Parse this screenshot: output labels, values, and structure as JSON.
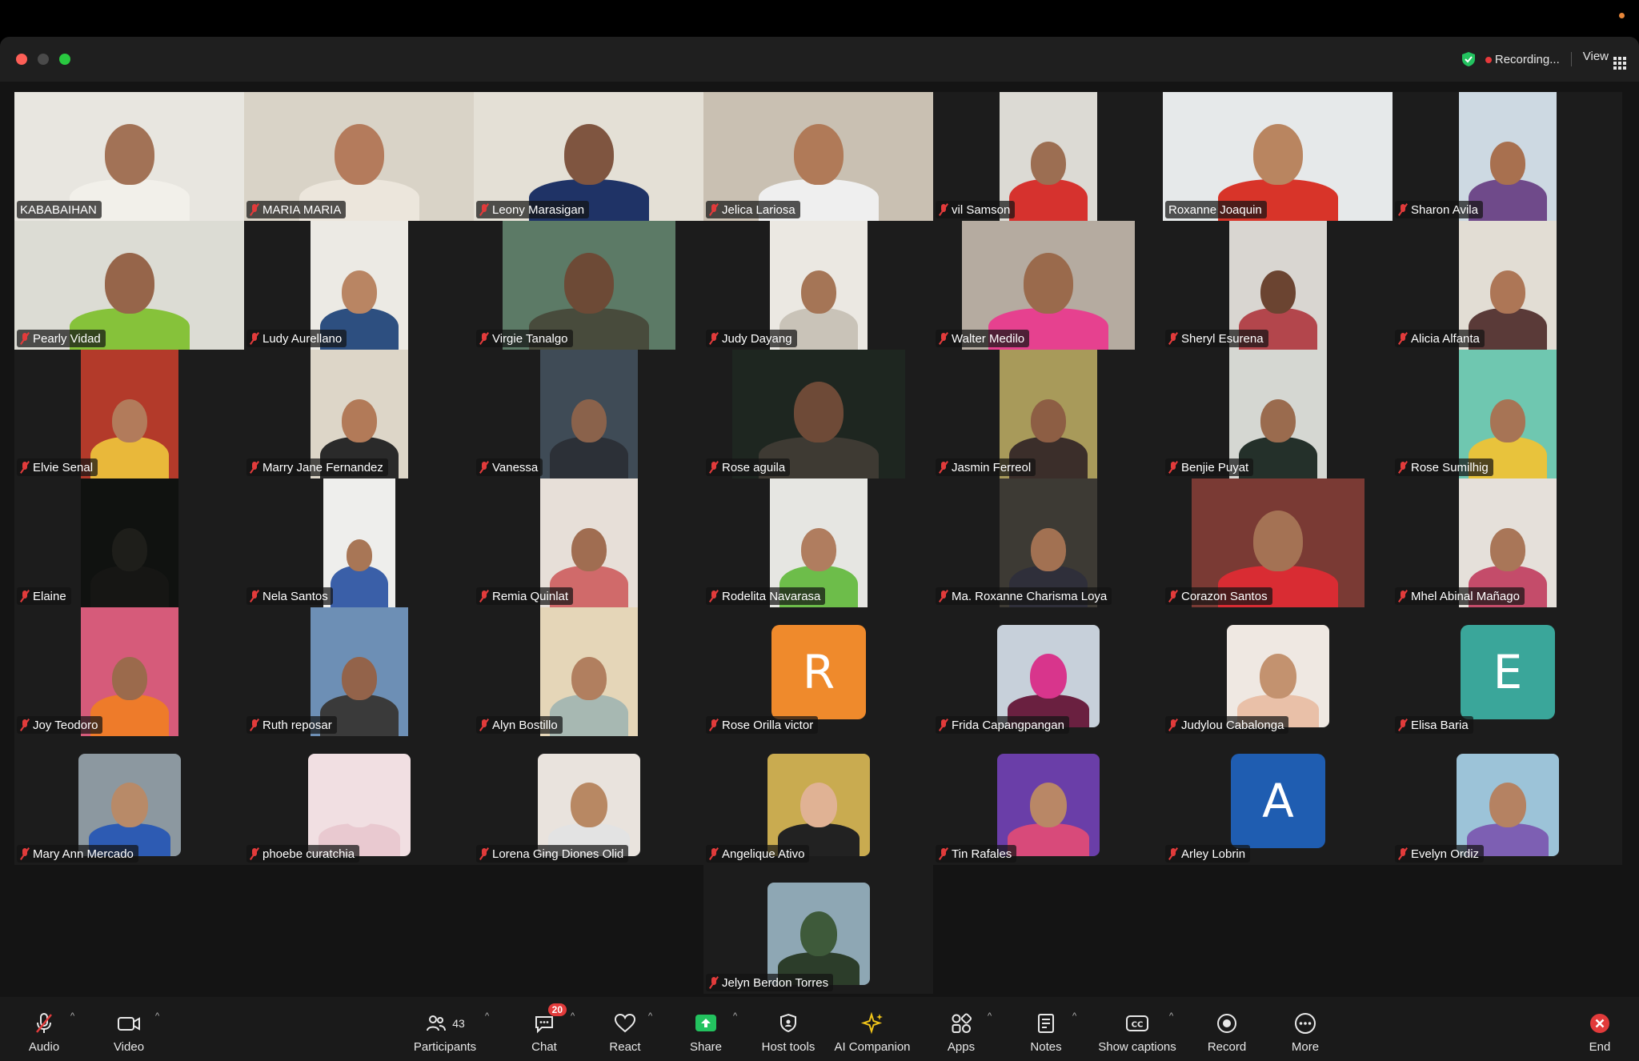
{
  "window": {
    "recording_label": "Recording...",
    "view_label": "View"
  },
  "participants": [
    {
      "name": "KABABAIHAN",
      "muted": false,
      "kind": "video",
      "bg": "#e8e6e0",
      "skin": "#a27256",
      "shirt": "#f2f0ea"
    },
    {
      "name": "MARIA MARIA",
      "muted": true,
      "kind": "video",
      "bg": "#d9d3c7",
      "skin": "#b47b5c",
      "shirt": "#ece6dc"
    },
    {
      "name": "Leony Marasigan",
      "muted": true,
      "kind": "video",
      "bg": "#e4e0d6",
      "skin": "#7f5540",
      "shirt": "#1f3366"
    },
    {
      "name": "Jelica Lariosa",
      "muted": true,
      "kind": "video",
      "bg": "#c9c0b2",
      "skin": "#b07a58",
      "shirt": "#efefef"
    },
    {
      "name": "vil Samson",
      "muted": true,
      "kind": "video",
      "bg": "#dcdad4",
      "skin": "#9c6e52",
      "shirt": "#d6322e"
    },
    {
      "name": "Roxanne Joaquin",
      "muted": false,
      "kind": "video",
      "bg": "#e6e9ea",
      "skin": "#b98560",
      "shirt": "#d83429"
    },
    {
      "name": "Sharon Avila",
      "muted": true,
      "kind": "video",
      "bg": "#cdd9e2",
      "skin": "#a8704f",
      "shirt": "#6f4a8a"
    },
    {
      "name": "Pearly Vidad",
      "muted": true,
      "kind": "video",
      "bg": "#dcdcd4",
      "skin": "#96654a",
      "shirt": "#86c23a"
    },
    {
      "name": "Ludy Aurellano",
      "muted": true,
      "kind": "video",
      "bg": "#eceae4",
      "skin": "#b98563",
      "shirt": "#2d4f80"
    },
    {
      "name": "Virgie Tanalgo",
      "muted": true,
      "kind": "video",
      "bg": "#5c7a66",
      "skin": "#6d4a36",
      "shirt": "#484b3c"
    },
    {
      "name": "Judy Dayang",
      "muted": true,
      "kind": "video",
      "bg": "#ebe8e2",
      "skin": "#a57556",
      "shirt": "#c9c3b8"
    },
    {
      "name": "Walter Medilo",
      "muted": true,
      "kind": "video",
      "bg": "#b5aba0",
      "skin": "#9a6a4c",
      "shirt": "#e6418f"
    },
    {
      "name": "Sheryl Esurena",
      "muted": true,
      "kind": "video",
      "bg": "#d9d6d1",
      "skin": "#6b4431",
      "shirt": "#b3464c"
    },
    {
      "name": "Alicia Alfanta",
      "muted": true,
      "kind": "video",
      "bg": "#e2ddd4",
      "skin": "#ad7656",
      "shirt": "#5a3a38"
    },
    {
      "name": "Elvie Senal",
      "muted": true,
      "kind": "video",
      "bg": "#b33a2a",
      "skin": "#b27b5b",
      "shirt": "#e9b83a"
    },
    {
      "name": "Marry Jane Fernandez",
      "muted": true,
      "kind": "video",
      "bg": "#ddd6c8",
      "skin": "#b27a58",
      "shirt": "#2a2a2a"
    },
    {
      "name": "Vanessa",
      "muted": true,
      "kind": "video",
      "bg": "#3f4b56",
      "skin": "#8a624b",
      "shirt": "#2c3037"
    },
    {
      "name": "Rose aguila",
      "muted": true,
      "kind": "video",
      "bg": "#1e2620",
      "skin": "#6e4a37",
      "shirt": "#3e3a33"
    },
    {
      "name": "Jasmin Ferreol",
      "muted": true,
      "kind": "video",
      "bg": "#a89a5a",
      "skin": "#8d5e44",
      "shirt": "#3b2e2a"
    },
    {
      "name": "Benjie Puyat",
      "muted": true,
      "kind": "video",
      "bg": "#d5d7d2",
      "skin": "#9a6b4e",
      "shirt": "#24302a"
    },
    {
      "name": "Rose Sumilhig",
      "muted": true,
      "kind": "video",
      "bg": "#6fc7b0",
      "skin": "#a77455",
      "shirt": "#e8c33c"
    },
    {
      "name": "Elaine",
      "muted": true,
      "kind": "video",
      "bg": "#101210",
      "skin": "#1e1e1a",
      "shirt": "#161614"
    },
    {
      "name": "Nela Santos",
      "muted": true,
      "kind": "video",
      "bg": "#eeeeec",
      "skin": "#a87656",
      "shirt": "#3a5fa8"
    },
    {
      "name": "Remia Quinlat",
      "muted": true,
      "kind": "video",
      "bg": "#e7dfd8",
      "skin": "#a06d51",
      "shirt": "#d06a6a"
    },
    {
      "name": "Rodelita Navarasa",
      "muted": true,
      "kind": "video",
      "bg": "#e6e6e2",
      "skin": "#b07d5f",
      "shirt": "#6dbd4a"
    },
    {
      "name": "Ma. Roxanne Charisma Loya",
      "muted": true,
      "kind": "video",
      "bg": "#3d3a34",
      "skin": "#a27152",
      "shirt": "#2f2f3a"
    },
    {
      "name": "Corazon Santos",
      "muted": true,
      "kind": "video",
      "bg": "#7a3a34",
      "skin": "#a47254",
      "shirt": "#d92c33"
    },
    {
      "name": "Mhel Abinal Mañago",
      "muted": true,
      "kind": "video",
      "bg": "#e5e0da",
      "skin": "#a97658",
      "shirt": "#c44c6a"
    },
    {
      "name": "Joy Teodoro",
      "muted": true,
      "kind": "video",
      "bg": "#d65b7a",
      "skin": "#9b6a4c",
      "shirt": "#ee7b2a"
    },
    {
      "name": "Ruth reposar",
      "muted": true,
      "kind": "video",
      "bg": "#6d8fb5",
      "skin": "#93634a",
      "shirt": "#3a3a3a"
    },
    {
      "name": "Alyn Bostillo",
      "muted": true,
      "kind": "video",
      "bg": "#e5d6b8",
      "skin": "#b17f5f",
      "shirt": "#a7b8b2"
    },
    {
      "name": "Rose Orilla victor",
      "muted": true,
      "kind": "letter",
      "letter": "R",
      "color": "#ef8a2c"
    },
    {
      "name": "Frida Capangpangan",
      "muted": true,
      "kind": "photo",
      "bg": "#c7d0da",
      "skin": "#d8358c",
      "shirt": "#6a2040"
    },
    {
      "name": "Judylou Cabalonga",
      "muted": true,
      "kind": "photo",
      "bg": "#efe8e2",
      "skin": "#c3926f",
      "shirt": "#e9c0a8"
    },
    {
      "name": "Elisa Baria",
      "muted": true,
      "kind": "letter",
      "letter": "E",
      "color": "#3aa69a"
    },
    {
      "name": "Mary Ann Mercado",
      "muted": true,
      "kind": "photo",
      "bg": "#8c98a0",
      "skin": "#b88a68",
      "shirt": "#2d5bb3"
    },
    {
      "name": "phoebe curatchia",
      "muted": true,
      "kind": "photo",
      "bg": "#f1dfe2",
      "skin": "#f1dfe2",
      "shirt": "#e9c9d0"
    },
    {
      "name": "Lorena Ging Diones Olid",
      "muted": true,
      "kind": "photo",
      "bg": "#e9e3dd",
      "skin": "#b88863",
      "shirt": "#e3e3e3"
    },
    {
      "name": "Angelique Ativo",
      "muted": true,
      "kind": "photo",
      "bg": "#c9ab50",
      "skin": "#e0b294",
      "shirt": "#222"
    },
    {
      "name": "Tin Rafales",
      "muted": true,
      "kind": "photo",
      "bg": "#6a3ea8",
      "skin": "#b98766",
      "shirt": "#d84a7a"
    },
    {
      "name": "Arley Lobrin",
      "muted": true,
      "kind": "letter",
      "letter": "A",
      "color": "#1f5db1"
    },
    {
      "name": "Evelyn Ordiz",
      "muted": true,
      "kind": "photo",
      "bg": "#9cc3d8",
      "skin": "#b58262",
      "shirt": "#7d5fb3"
    },
    {
      "name": "Jelyn Berdon Torres",
      "muted": true,
      "kind": "photo",
      "bg": "#8ea7b4",
      "skin": "#3e5a3a",
      "shirt": "#2c3d2a"
    }
  ],
  "toolbar": {
    "audio": "Audio",
    "video": "Video",
    "participants": "Participants",
    "participants_count": "43",
    "chat": "Chat",
    "chat_badge": "20",
    "react": "React",
    "share": "Share",
    "host_tools": "Host tools",
    "ai_companion": "AI Companion",
    "apps": "Apps",
    "notes": "Notes",
    "show_captions": "Show captions",
    "record": "Record",
    "more": "More",
    "end": "End",
    "colors": {
      "share_green": "#23c25f",
      "end_red": "#e23b3b",
      "muted_red": "#e23b3b"
    }
  }
}
